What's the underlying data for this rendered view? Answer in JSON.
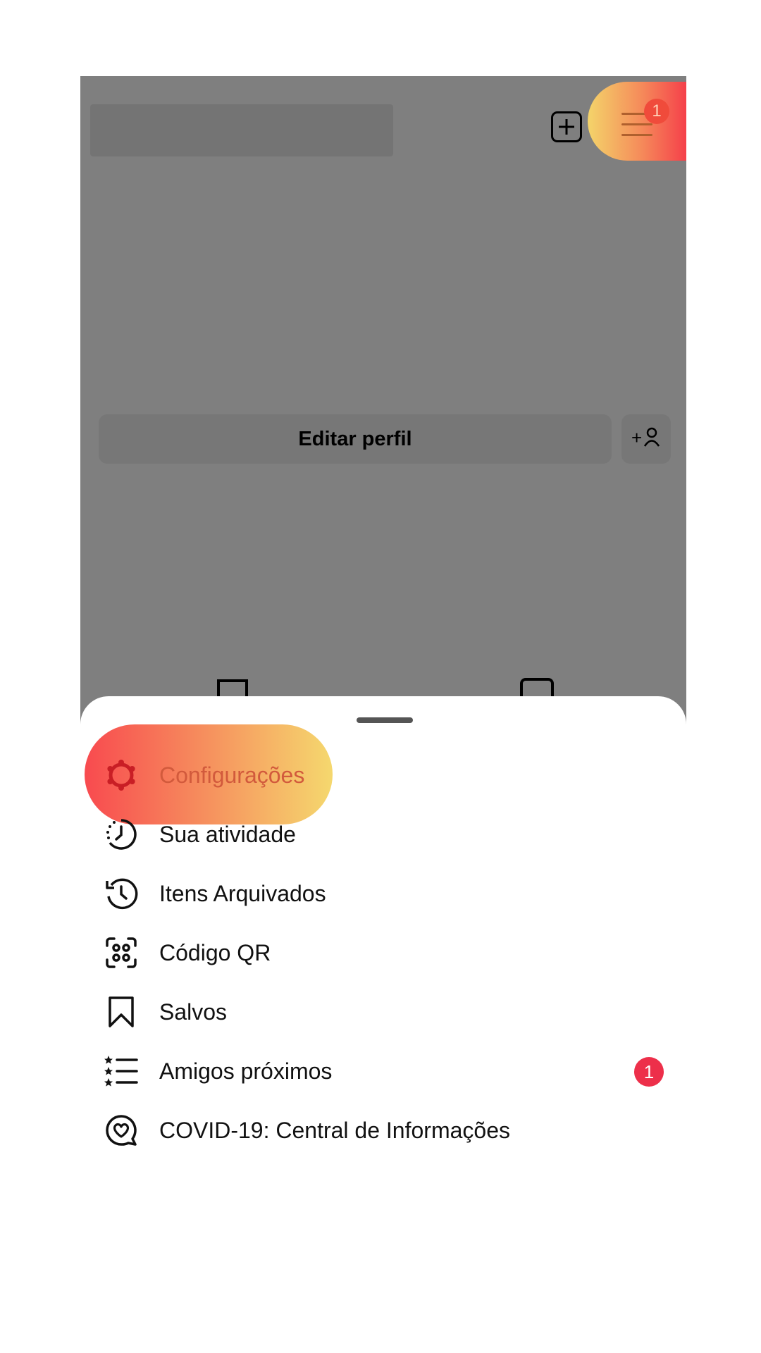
{
  "profile": {
    "edit_profile_label": "Editar perfil",
    "discover_people_plus": "+"
  },
  "menu": {
    "notification_count": "1",
    "items": [
      {
        "label": "Configurações",
        "icon": "gear-icon"
      },
      {
        "label": "Sua atividade",
        "icon": "activity-clock-icon"
      },
      {
        "label": "Itens Arquivados",
        "icon": "archive-history-icon"
      },
      {
        "label": "Código QR",
        "icon": "qr-code-icon"
      },
      {
        "label": "Salvos",
        "icon": "bookmark-icon"
      },
      {
        "label": "Amigos próximos",
        "icon": "close-friends-list-icon",
        "badge": "1"
      },
      {
        "label": "COVID-19: Central de Informações",
        "icon": "covid-heart-icon"
      }
    ]
  },
  "colors": {
    "highlight_start": "#f84a4f",
    "highlight_end": "#f5d86e",
    "badge_red": "#ed2f4a",
    "overlay": "rgba(0,0,0,0.5)"
  }
}
